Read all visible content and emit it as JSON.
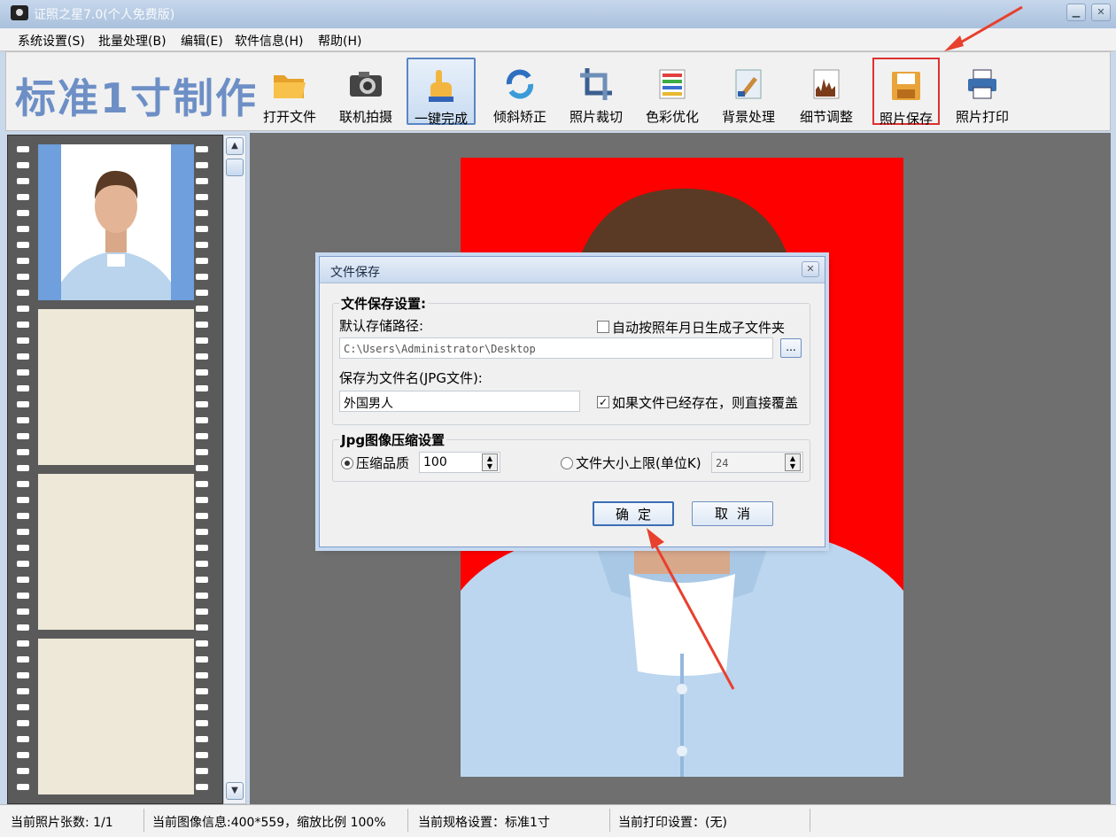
{
  "window": {
    "title": "证照之星7.0(个人免费版)"
  },
  "menu": [
    {
      "label": "系统设置(S)"
    },
    {
      "label": "批量处理(B)"
    },
    {
      "label": "编辑(E)"
    },
    {
      "label": "软件信息(H)"
    },
    {
      "label": "帮助(H)"
    }
  ],
  "toolbar": {
    "heading": "标准1寸制作",
    "tools": [
      {
        "label": "打开文件",
        "icon": "folder-icon"
      },
      {
        "label": "联机拍摄",
        "icon": "camera-icon"
      },
      {
        "label": "一键完成",
        "icon": "hand-icon"
      },
      {
        "label": "倾斜矫正",
        "icon": "rotate-icon"
      },
      {
        "label": "照片裁切",
        "icon": "crop-icon"
      },
      {
        "label": "色彩优化",
        "icon": "color-bars-icon"
      },
      {
        "label": "背景处理",
        "icon": "brush-icon"
      },
      {
        "label": "细节调整",
        "icon": "histogram-icon"
      },
      {
        "label": "照片保存",
        "icon": "floppy-disk-icon"
      },
      {
        "label": "照片打印",
        "icon": "printer-icon"
      }
    ]
  },
  "dialog": {
    "title": "文件保存",
    "save_settings_legend": "文件保存设置:",
    "default_path_label": "默认存储路径:",
    "auto_folder_label": "自动按照年月日生成子文件夹",
    "auto_folder_checked": false,
    "path_value": "C:\\Users\\Administrator\\Desktop",
    "browse_label": "...",
    "filename_label": "保存为文件名(JPG文件):",
    "filename_value": "外国男人",
    "overwrite_label": "如果文件已经存在，则直接覆盖",
    "overwrite_checked": true,
    "jpg_legend": "Jpg图像压缩设置",
    "quality_label": "压缩品质",
    "quality_value": "100",
    "size_limit_label": "文件大小上限(单位K)",
    "size_limit_value": "24",
    "ok_label": "确定",
    "cancel_label": "取消"
  },
  "status": {
    "count": "当前照片张数: 1/1",
    "image_info": "当前图像信息:400*559，缩放比例 100%",
    "spec": "当前规格设置：标准1寸",
    "print": "当前打印设置：(无)"
  },
  "colors": {
    "photo_background": "#ff0000",
    "heading": "#6d8fc6",
    "annotation_arrow": "#e8402e"
  }
}
